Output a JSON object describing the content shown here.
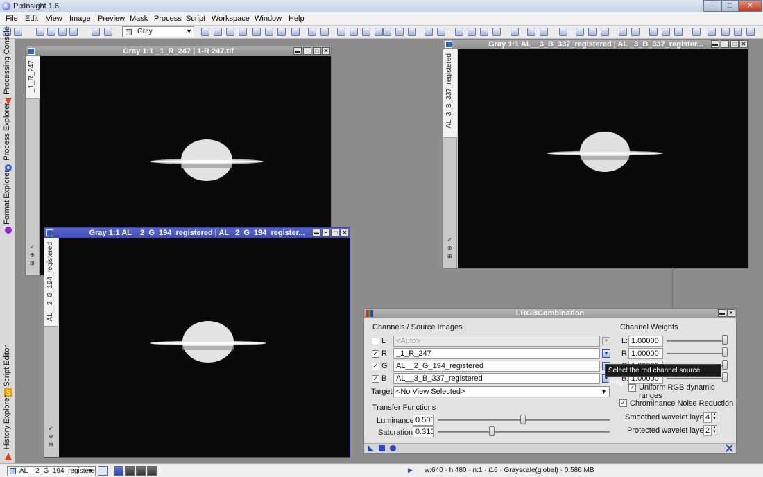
{
  "app": {
    "title": "PixInsight 1.6"
  },
  "window_controls": {
    "minimize": "–",
    "maximize": "□",
    "close": "✕"
  },
  "menu": [
    "File",
    "Edit",
    "View",
    "Image",
    "Preview",
    "Mask",
    "Process",
    "Script",
    "Workspace",
    "Window",
    "Help"
  ],
  "toolbar": {
    "mode_combo": "Gray"
  },
  "sidebar": {
    "tabs": [
      {
        "label": "Processing Console",
        "icon": "triangle-icon",
        "color": "#e0401a"
      },
      {
        "label": "Process Explorer",
        "icon": "gear-icon",
        "color": "#3a5fcf"
      },
      {
        "label": "Format Explorer",
        "icon": "sphere-icon",
        "color": "#8a2bd6"
      },
      {
        "label": "Script Editor",
        "icon": "script-s-icon",
        "color": "#e6a000"
      },
      {
        "label": "History Explorer",
        "icon": "triangle-icon",
        "color": "#e0401a"
      }
    ]
  },
  "image_windows": [
    {
      "title": "Gray 1:1 _1_R_247 | 1-R 247.tif",
      "tab": "_1_R_247",
      "active": false
    },
    {
      "title": "Gray 1:1 AL__3_B_337_registered | AL _3_B_337_register...",
      "tab": "AL_3_B_337_registered",
      "active": false
    },
    {
      "title": "Gray 1:1 AL__2_G_194_registered | AL _2_G_194_register...",
      "tab": "AL__2_G_194_registered",
      "active": true
    }
  ],
  "window_buttons": {
    "shade": "▬",
    "minimize": "–",
    "maximize": "□",
    "close": "✕"
  },
  "lrgb": {
    "title": "LRGBCombination",
    "channels_header": "Channels / Source Images",
    "channels": [
      {
        "letter": "L",
        "checked": false,
        "check_mark": "",
        "source": "<Auto>",
        "enabled": false
      },
      {
        "letter": "R",
        "checked": true,
        "check_mark": "✓",
        "source": "_1_R_247",
        "enabled": true
      },
      {
        "letter": "G",
        "checked": true,
        "check_mark": "✓",
        "source": "AL__2_G_194_registered",
        "enabled": true
      },
      {
        "letter": "B",
        "checked": true,
        "check_mark": "✓",
        "source": "AL__3_B_337_registered",
        "enabled": true
      }
    ],
    "target_label": "Target:",
    "target_value": "<No View Selected>",
    "transfer_header": "Transfer Functions",
    "luminance_label": "Luminance:",
    "luminance_value": "0.500",
    "saturation_label": "Saturation:",
    "saturation_value": "0.310",
    "weights_header": "Channel Weights",
    "weights": [
      {
        "label": "L:",
        "value": "1.00000"
      },
      {
        "label": "R:",
        "value": "1.00000"
      },
      {
        "label": "G:",
        "value": "1.00000"
      },
      {
        "label": "B:",
        "value": "1.00000"
      }
    ],
    "uniform_label": "Uniform RGB dynamic ranges",
    "chroma_label": "Chrominance Noise Reduction",
    "smoothed_label": "Smoothed wavelet layers:",
    "smoothed_value": "4",
    "protected_label": "Protected wavelet layers:",
    "protected_value": "2",
    "check_mark": "✓",
    "tooltip": "Select the red channel source image"
  },
  "statusbar": {
    "view": "AL__2_G_194_registered",
    "info": "w:640 · h:480 · n:1 · i16 · Grayscale(global) · 0.586 MB"
  }
}
